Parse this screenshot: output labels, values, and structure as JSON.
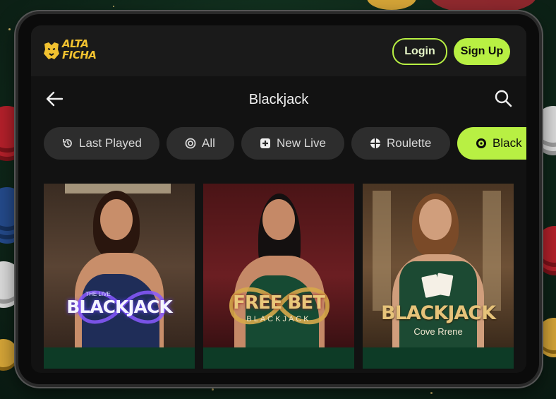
{
  "brand": {
    "name": "Alta Ficha",
    "accent": "#b8f043",
    "logo_color": "#f2c230"
  },
  "header": {
    "logo_text": "ALTA FICHA",
    "login_label": "Login",
    "signup_label": "Sign Up"
  },
  "nav": {
    "back_icon": "arrow-left-icon",
    "title": "Blackjack",
    "search_icon": "search-icon"
  },
  "categories": [
    {
      "label": "Last Played",
      "icon": "history-icon",
      "active": false
    },
    {
      "label": "All",
      "icon": "target-icon",
      "active": false
    },
    {
      "label": "New Live",
      "icon": "plus-square-icon",
      "active": false
    },
    {
      "label": "Roulette",
      "icon": "roulette-icon",
      "active": false
    },
    {
      "label": "Black",
      "icon": "blackjack-icon",
      "active": true
    }
  ],
  "games": [
    {
      "title": "BLACKJACK",
      "title_prefix": "THE LIVE",
      "subtitle": ""
    },
    {
      "title": "FREE BET",
      "subtitle": "BLACKJACK"
    },
    {
      "title": "BLACKJACK",
      "subtitle": "Cove Rrene"
    }
  ]
}
